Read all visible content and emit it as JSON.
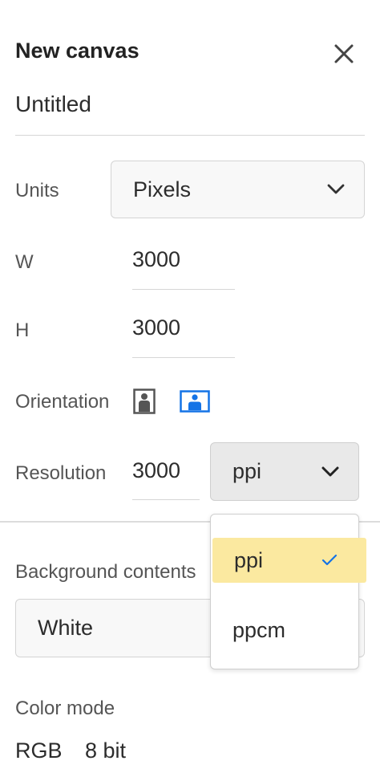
{
  "header": {
    "title": "New canvas"
  },
  "document": {
    "name": "Untitled"
  },
  "units": {
    "label": "Units",
    "value": "Pixels"
  },
  "size": {
    "width_label": "W",
    "width_value": "3000",
    "height_label": "H",
    "height_value": "3000"
  },
  "orientation": {
    "label": "Orientation",
    "options": [
      "portrait",
      "landscape"
    ],
    "selected": "landscape",
    "accent": "#1473e6"
  },
  "resolution": {
    "label": "Resolution",
    "value": "3000",
    "unit": "ppi",
    "dropdown": {
      "options": [
        {
          "label": "ppi",
          "selected": true
        },
        {
          "label": "ppcm",
          "selected": false
        }
      ],
      "highlight_color": "#fbe9a0",
      "check_color": "#1473e6"
    }
  },
  "background": {
    "label": "Background contents",
    "value": "White"
  },
  "color_mode": {
    "label": "Color mode",
    "mode": "RGB",
    "depth": "8 bit"
  }
}
